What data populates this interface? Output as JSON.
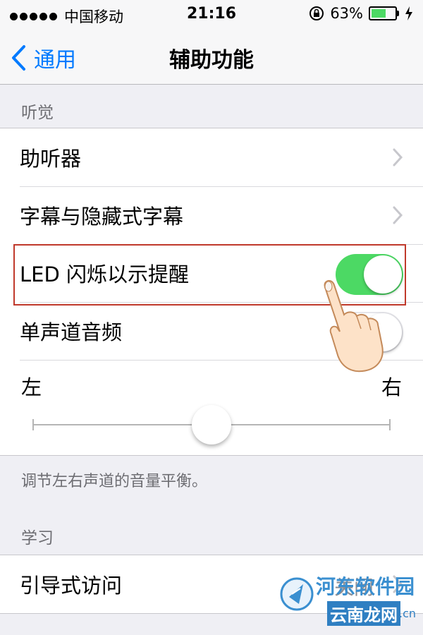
{
  "status": {
    "carrier": "中国移动",
    "time": "21:16",
    "battery": "63%",
    "battery_level": 0.63
  },
  "nav": {
    "back_label": "通用",
    "title": "辅助功能"
  },
  "hearing": {
    "header": "听觉",
    "items": [
      {
        "label": "助听器"
      },
      {
        "label": "字幕与隐藏式字幕"
      },
      {
        "label": "LED 闪烁以示提醒",
        "toggle": "on"
      },
      {
        "label": "单声道音频",
        "toggle": "off"
      }
    ],
    "balance": {
      "left": "左",
      "right": "右",
      "value": 0.5
    },
    "footer": "调节左右声道的音量平衡。"
  },
  "learning": {
    "header": "学习",
    "items": [
      {
        "label": "引导式访问",
        "value": "关闭"
      }
    ]
  },
  "watermark": {
    "top": "河东软件园",
    "bottom": "云南龙网",
    "suffix": ".cn"
  },
  "colors": {
    "accent": "#007aff",
    "toggle_on": "#4cd964",
    "highlight": "#c0392b"
  }
}
